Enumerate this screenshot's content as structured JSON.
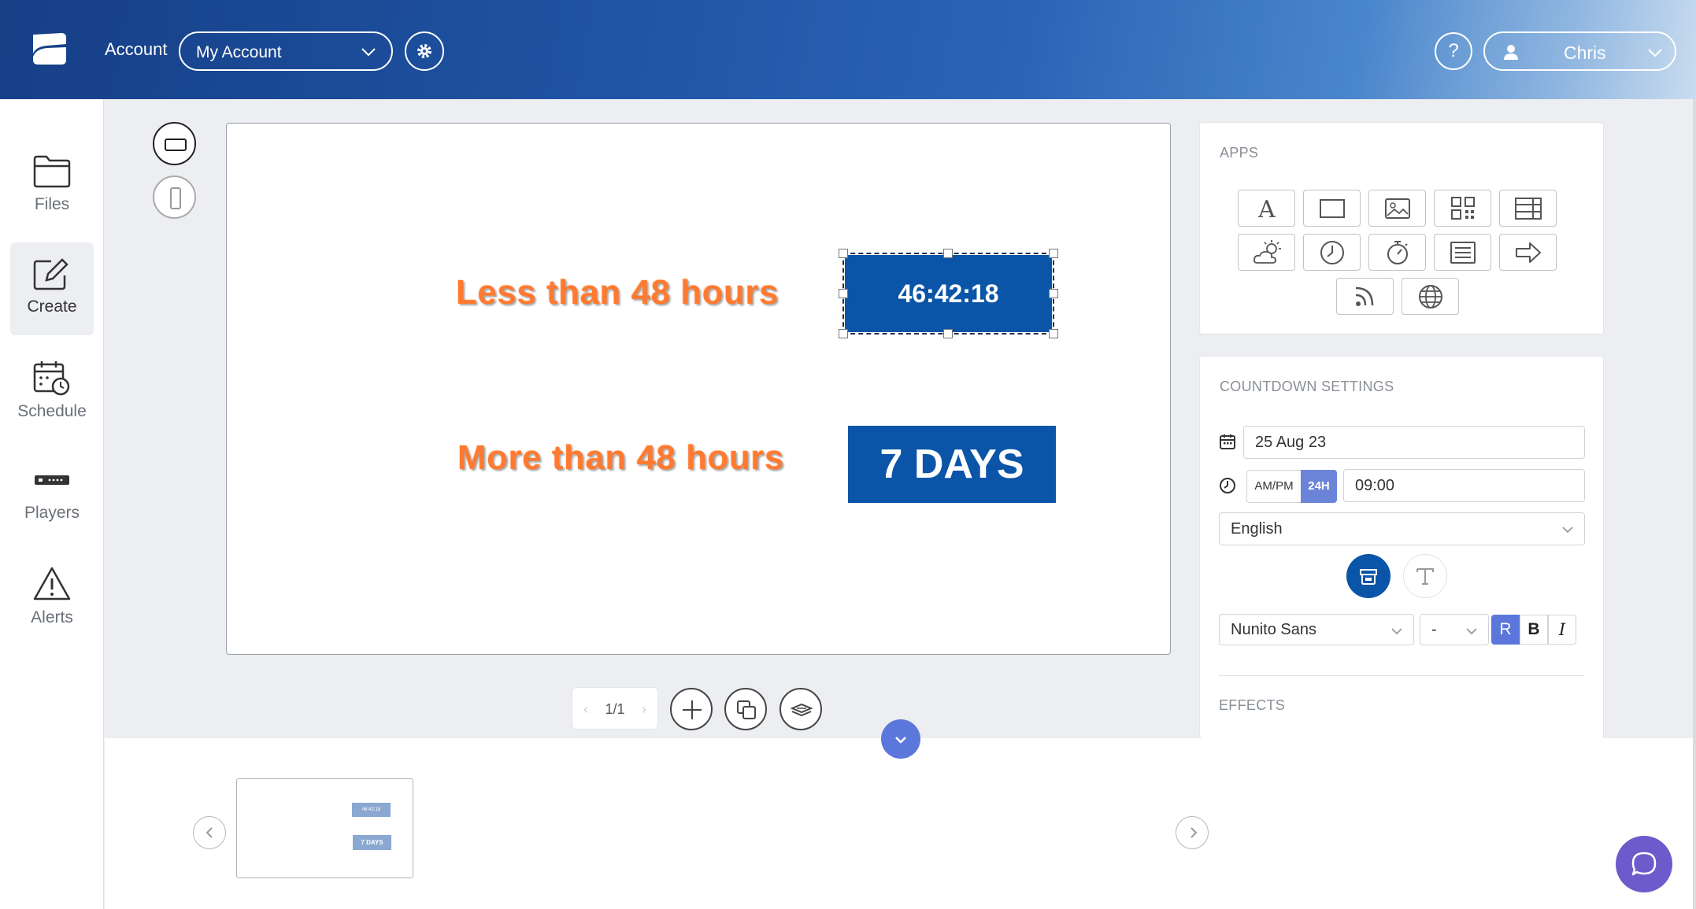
{
  "header": {
    "account_label": "Account",
    "account_select": "My Account",
    "help": "?",
    "user_name": "Chris"
  },
  "sidebar": {
    "items": [
      {
        "label": "Files",
        "icon": "folder-icon"
      },
      {
        "label": "Create",
        "icon": "edit-icon",
        "active": true
      },
      {
        "label": "Schedule",
        "icon": "calendar-clock-icon"
      },
      {
        "label": "Players",
        "icon": "player-device-icon"
      },
      {
        "label": "Alerts",
        "icon": "warning-icon"
      }
    ]
  },
  "canvas": {
    "label_less": "Less than 48 hours",
    "timer": "46:42:18",
    "label_more": "More than 48 hours",
    "days": "7 DAYS"
  },
  "pager": {
    "page": "1/1",
    "prev": "‹",
    "next": "›"
  },
  "apps_panel": {
    "title": "APPS",
    "apps": [
      "text-icon",
      "rectangle-icon",
      "image-icon",
      "qr-code-icon",
      "table-icon",
      "weather-icon",
      "clock-icon",
      "countdown-icon",
      "list-icon",
      "arrow-icon",
      "rss-icon",
      "web-icon"
    ]
  },
  "countdown_settings": {
    "title": "COUNTDOWN SETTINGS",
    "date": "25 Aug 23",
    "ampm_label": "AM/PM",
    "h24_label": "24H",
    "time": "09:00",
    "language": "English",
    "font": "Nunito Sans",
    "size": "-",
    "regular": "R",
    "bold": "B",
    "italic": "I"
  },
  "effects": {
    "title": "EFFECTS"
  },
  "thumbnail": {
    "timer": "46:42:18",
    "days": "7 DAYS"
  },
  "colors": {
    "brand_blue": "#0a55a8",
    "accent_purple": "#6d5acb",
    "label_orange": "#ff7a30"
  }
}
